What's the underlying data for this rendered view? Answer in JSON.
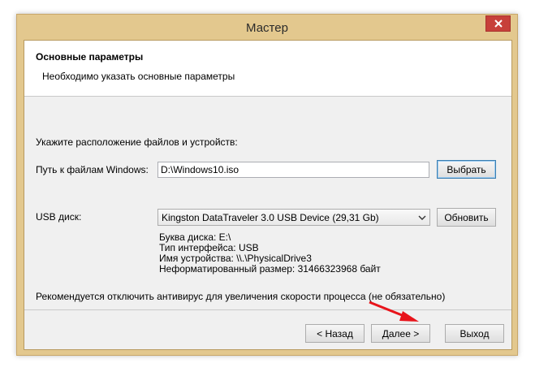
{
  "window": {
    "title": "Мастер",
    "close_symbol": "✕"
  },
  "header": {
    "title": "Основные параметры",
    "subtitle": "Необходимо указать основные параметры"
  },
  "main": {
    "instruction": "Укажите расположение файлов и устройств:",
    "windows_path": {
      "label": "Путь к файлам Windows:",
      "value": "D:\\Windows10.iso",
      "browse_label": "Выбрать"
    },
    "usb": {
      "label": "USB диск:",
      "selected": "Kingston DataTraveler 3.0 USB Device (29,31 Gb)",
      "refresh_label": "Обновить",
      "info": [
        "Буква диска: E:\\",
        "Тип интерфейса: USB",
        "Имя устройства: \\\\.\\PhysicalDrive3",
        "Неформатированный размер: 31466323968 байт"
      ]
    },
    "recommendation": "Рекомендуется отключить антивирус для увеличения скорости процесса (не обязательно)"
  },
  "footer": {
    "back_label": "< Назад",
    "next_label": "Далее >",
    "exit_label": "Выход"
  },
  "colors": {
    "frame": "#e3c88e",
    "close_button": "#c7403a",
    "annotation_arrow": "#e8141b"
  }
}
